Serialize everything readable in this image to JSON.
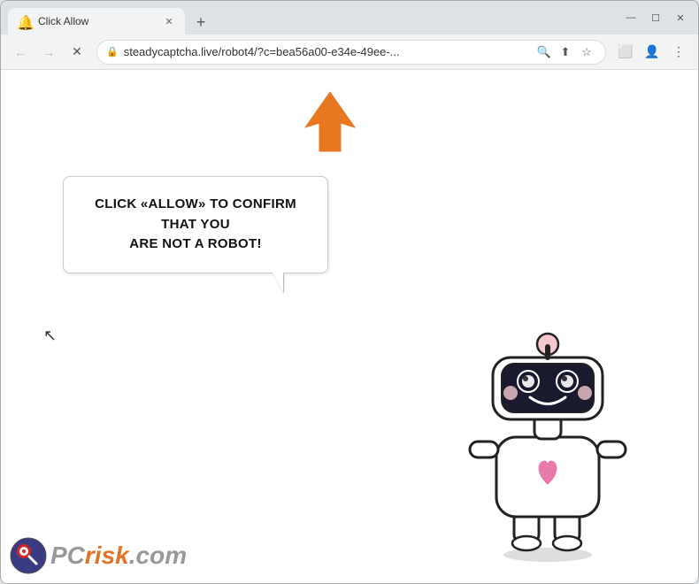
{
  "browser": {
    "tab": {
      "title": "Click Allow",
      "favicon": "🔔"
    },
    "new_tab_label": "+",
    "window_controls": {
      "minimize": "—",
      "maximize": "☐",
      "close": "✕"
    }
  },
  "toolbar": {
    "back_label": "←",
    "forward_label": "→",
    "reload_label": "✕",
    "address": "steadycaptcha.live/robot4/?c=bea56a00-e34e-49ee-...",
    "search_icon": "🔍",
    "share_icon": "⬆",
    "bookmark_icon": "☆",
    "extensions_icon": "⬜",
    "profile_icon": "👤",
    "menu_icon": "⋮"
  },
  "page": {
    "bubble_text_line1": "CLICK «ALLOW» TO CONFIRM THAT YOU",
    "bubble_text_line2": "ARE NOT A ROBOT!"
  },
  "watermark": {
    "pc_text": "PC",
    "risk_text": "risk",
    "dot_com": ".com"
  }
}
